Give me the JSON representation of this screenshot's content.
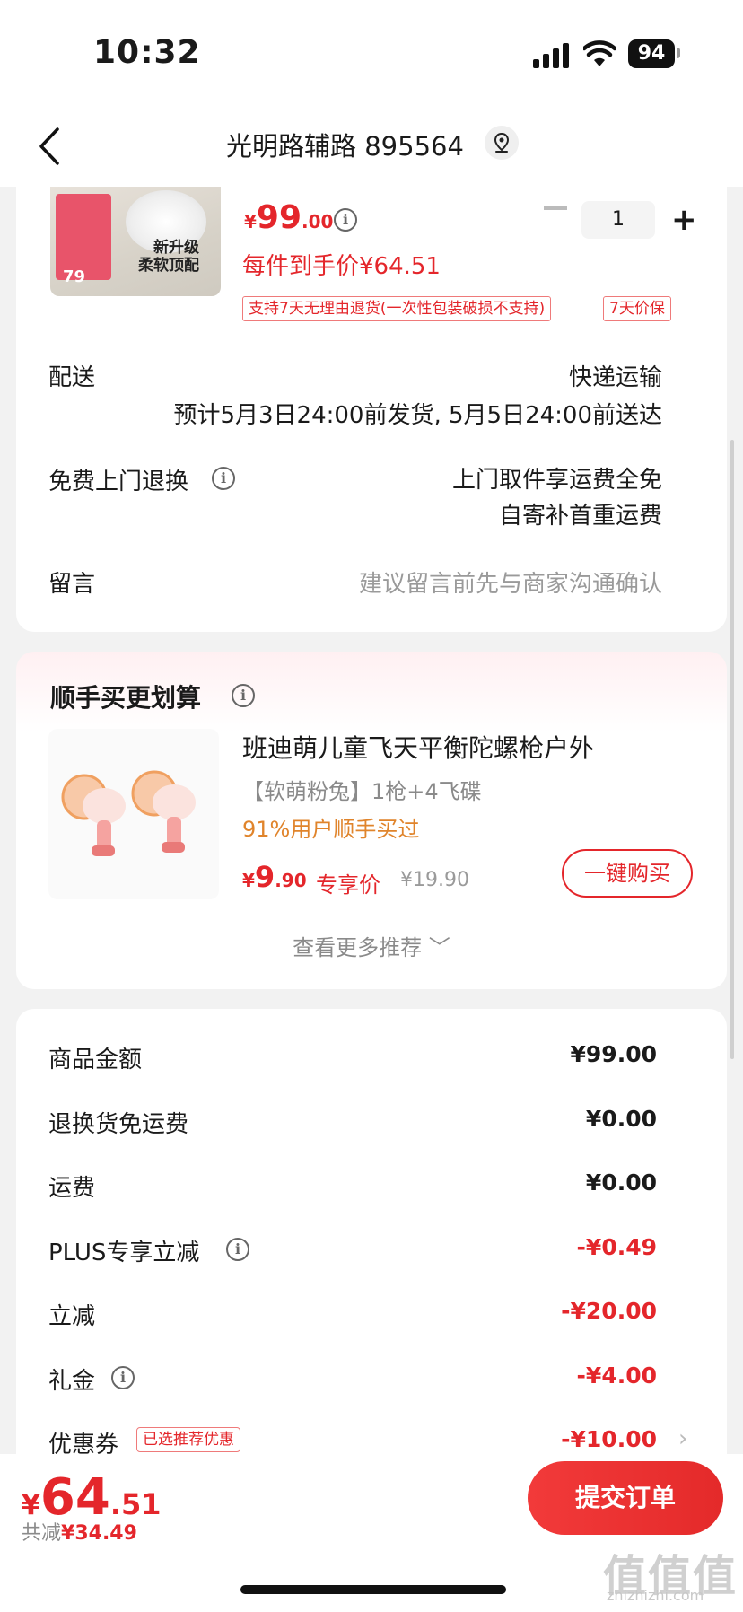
{
  "status_bar": {
    "time": "10:32",
    "battery": "94"
  },
  "nav": {
    "title": "光明路辅路 895564"
  },
  "product": {
    "thumb_tag": "新升级\n柔软顶配",
    "thumb_price": "79",
    "price_symbol": "¥",
    "price_int": "99",
    "price_dec": ".00",
    "quantity": "1",
    "per_item_price": "每件到手价¥64.51",
    "badges": [
      "支持7天无理由退货(一次性包装破损不支持)",
      "7天价保"
    ]
  },
  "delivery": {
    "label": "配送",
    "method": "快递运输",
    "estimate": "预计5月3日24:00前发货, 5月5日24:00前送达"
  },
  "free_return": {
    "label": "免费上门退换",
    "line1": "上门取件享运费全免",
    "line2": "自寄补首重运费"
  },
  "message": {
    "label": "留言",
    "placeholder": "建议留言前先与商家沟通确认"
  },
  "addon": {
    "title": "顺手买更划算",
    "product_name": "班迪萌儿童飞天平衡陀螺枪户外",
    "spec": "【软萌粉兔】1枪+4飞碟",
    "rate": "91%用户顺手买过",
    "price_symbol": "¥",
    "price_int": "9",
    "price_dec": ".90",
    "exclusive_label": "专享价",
    "original_price": "¥19.90",
    "buy_button": "一键购买",
    "more": "查看更多推荐 ﹀"
  },
  "summary": [
    {
      "label": "商品金额",
      "amount": "¥99.00",
      "red": false,
      "info": false
    },
    {
      "label": "退换货免运费",
      "amount": "¥0.00",
      "red": false,
      "info": false
    },
    {
      "label": "运费",
      "amount": "¥0.00",
      "red": false,
      "info": false
    },
    {
      "label": "PLUS专享立减",
      "amount": "-¥0.49",
      "red": true,
      "info": true
    },
    {
      "label": "立减",
      "amount": "-¥20.00",
      "red": true,
      "info": false
    },
    {
      "label": "礼金",
      "amount": "-¥4.00",
      "red": true,
      "info": true
    },
    {
      "label": "优惠券",
      "amount": "-¥10.00",
      "red": true,
      "info": false
    }
  ],
  "coupon_tag": "已选推荐优惠",
  "footer": {
    "total_symbol": "¥",
    "total_int": "64",
    "total_dec": ".51",
    "saved_prefix": "共减",
    "saved_amount": "¥34.49",
    "submit": "提交订单"
  },
  "watermark": {
    "text": "值值值",
    "url": "zhizhizhi.com"
  },
  "colors": {
    "accent": "#e4262b",
    "orange": "#e0842b",
    "muted": "#8a8a8a"
  }
}
